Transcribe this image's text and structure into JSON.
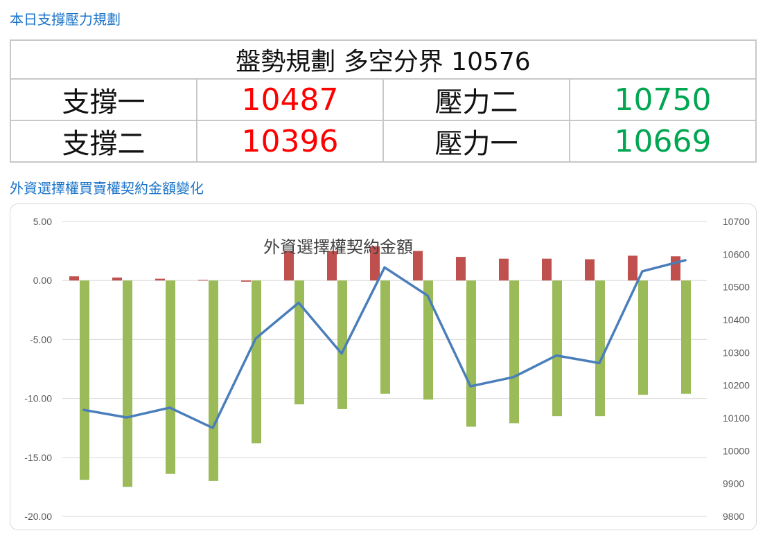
{
  "header": {
    "title": "本日支撐壓力規劃"
  },
  "plan": {
    "headline": "盤勢規劃 多空分界 10576",
    "rows": [
      {
        "support_label": "支撐一",
        "support_value": "10487",
        "resistance_label": "壓力二",
        "resistance_value": "10750"
      },
      {
        "support_label": "支撐二",
        "support_value": "10396",
        "resistance_label": "壓力一",
        "resistance_value": "10669"
      }
    ],
    "colors": {
      "support": "#ff0000",
      "resistance": "#00a651"
    }
  },
  "chart_section": {
    "title": "外資選擇權買賣權契約金額變化"
  },
  "chart_data": {
    "type": "bar",
    "title": "外資選擇權契約金額",
    "categories": [
      "",
      "",
      "",
      "",
      "",
      "",
      "",
      "",
      "",
      "",
      "",
      "",
      "",
      "",
      ""
    ],
    "left_axis": {
      "ylim": [
        -20,
        5
      ],
      "ticks": [
        "5.00",
        "0.00",
        "-5.00",
        "-10.00",
        "-15.00",
        "-20.00"
      ],
      "tick_values": [
        5,
        0,
        -5,
        -10,
        -15,
        -20
      ]
    },
    "right_axis": {
      "ylim": [
        9800,
        10700
      ],
      "ticks": [
        "10700",
        "10600",
        "10500",
        "10400",
        "10300",
        "10200",
        "10100",
        "10000",
        "9900",
        "9800"
      ],
      "tick_values": [
        10700,
        10600,
        10500,
        10400,
        10300,
        10200,
        10100,
        10000,
        9900,
        9800
      ]
    },
    "series": [
      {
        "type": "bar",
        "axis": "left",
        "color": "#c0504d",
        "values": [
          0.35,
          0.25,
          0.15,
          0.05,
          -0.1,
          2.5,
          2.5,
          2.9,
          2.5,
          2.0,
          1.85,
          1.85,
          1.8,
          2.1,
          2.05
        ]
      },
      {
        "type": "bar",
        "axis": "left",
        "color": "#9bbb59",
        "values": [
          -16.9,
          -17.5,
          -16.4,
          -17.0,
          -13.8,
          -10.5,
          -10.9,
          -9.6,
          -10.1,
          -12.4,
          -12.1,
          -11.5,
          -11.5,
          -9.7,
          -9.6
        ]
      },
      {
        "type": "line",
        "axis": "right",
        "color": "#4a7ebb",
        "values": [
          10125,
          10102,
          10132,
          10070,
          10343,
          10452,
          10297,
          10560,
          10474,
          10197,
          10225,
          10291,
          10268,
          10548,
          10582
        ]
      }
    ],
    "grid": true,
    "legend": "none"
  }
}
